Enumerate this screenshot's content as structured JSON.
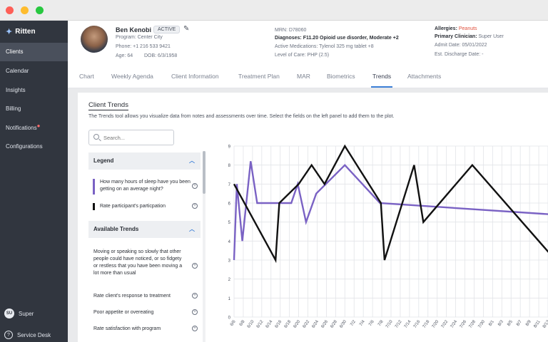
{
  "app": {
    "brand": "Ritten"
  },
  "sidebar": {
    "items": [
      {
        "label": "Clients",
        "active": true
      },
      {
        "label": "Calendar"
      },
      {
        "label": "Insights"
      },
      {
        "label": "Billing"
      },
      {
        "label": "Notifications",
        "has_alert": true
      },
      {
        "label": "Configurations"
      }
    ],
    "user": {
      "initials": "SU",
      "name": "Super"
    },
    "service_desk": "Service Desk"
  },
  "patient": {
    "name": "Ben Kenobi",
    "status": "ACTIVE",
    "program": "Program: Center City",
    "phone": "Phone: +1 216 533 9421",
    "age": "Age: 64",
    "dob": "DOB: 6/3/1958",
    "mrn": "MRN: D78060",
    "diagnoses_label": "Diagnoses:",
    "diagnoses": "F11.20 Opioid use disorder, Moderate +2",
    "medications": "Active Medications: Tylenol 325 mg tablet +8",
    "level_of_care": "Level of Care: PHP (2.5)",
    "allergies_label": "Allergies:",
    "allergies": "Peanuts",
    "clinician_label": "Primary Clinician:",
    "clinician": "Super User",
    "admit_date": "Admit Date: 05/01/2022",
    "discharge_date": "Est. Discharge Date: -"
  },
  "tabs": [
    "Chart",
    "Weekly Agenda",
    "Client Information",
    "Treatment Plan",
    "MAR",
    "Biometrics",
    "Trends",
    "Attachments"
  ],
  "active_tab": "Trends",
  "trends": {
    "title": "Client Trends",
    "description": "The Trends tool allows you visualize data from notes and assessments over time. Select the fields on the left panel to add them to the plot.",
    "search_placeholder": "Search...",
    "legend_header": "Legend",
    "legend_items": [
      {
        "label": "How many hours of sleep have you been getting on an average night?",
        "color": "#7a62c4"
      },
      {
        "label": "Rate participant's particpation",
        "color": "#111111"
      }
    ],
    "available_header": "Available Trends",
    "available_items": [
      "Moving or speaking so slowly that other people could have noticed, or so fidgety or restless that you have been moving a lot more than usual",
      "Rate client's response to treatment",
      "Poor appetite or overeating",
      "Rate satisfaction with program"
    ]
  },
  "chart_data": {
    "type": "line",
    "title": "",
    "xlabel": "",
    "ylabel": "",
    "ylim": [
      0,
      9
    ],
    "yticks": [
      0,
      1,
      2,
      3,
      4,
      5,
      6,
      7,
      8,
      9
    ],
    "grid": true,
    "x": [
      "6/6",
      "6/8",
      "6/10",
      "6/12",
      "6/14",
      "6/16",
      "6/18",
      "6/20",
      "6/22",
      "6/24",
      "6/26",
      "6/28",
      "6/30",
      "7/2",
      "7/4",
      "7/6",
      "7/8",
      "7/10",
      "7/12",
      "7/14",
      "7/16",
      "7/18",
      "7/20",
      "7/22",
      "7/24",
      "7/26",
      "7/28",
      "7/30",
      "8/1",
      "8/3",
      "8/5",
      "8/7",
      "8/9",
      "8/11",
      "8/13"
    ],
    "series": [
      {
        "color": "#7a62c4",
        "points": [
          [
            0.0,
            3
          ],
          [
            0.3,
            7
          ],
          [
            0.9,
            4
          ],
          [
            1.8,
            8.2
          ],
          [
            2.5,
            6
          ],
          [
            4.7,
            6
          ],
          [
            6.2,
            6
          ],
          [
            6.9,
            7
          ],
          [
            7.8,
            5
          ],
          [
            8.9,
            6.5
          ],
          [
            12.0,
            8
          ],
          [
            15.8,
            6
          ],
          [
            34.5,
            5.4
          ]
        ]
      },
      {
        "color": "#111111",
        "points": [
          [
            0.0,
            7
          ],
          [
            4.5,
            3
          ],
          [
            4.9,
            6
          ],
          [
            7.0,
            7
          ],
          [
            8.4,
            8
          ],
          [
            9.8,
            7
          ],
          [
            12.0,
            9
          ],
          [
            15.9,
            6
          ],
          [
            16.3,
            3
          ],
          [
            19.5,
            8
          ],
          [
            20.5,
            5
          ],
          [
            25.8,
            8
          ],
          [
            34.8,
            3
          ]
        ]
      }
    ]
  }
}
